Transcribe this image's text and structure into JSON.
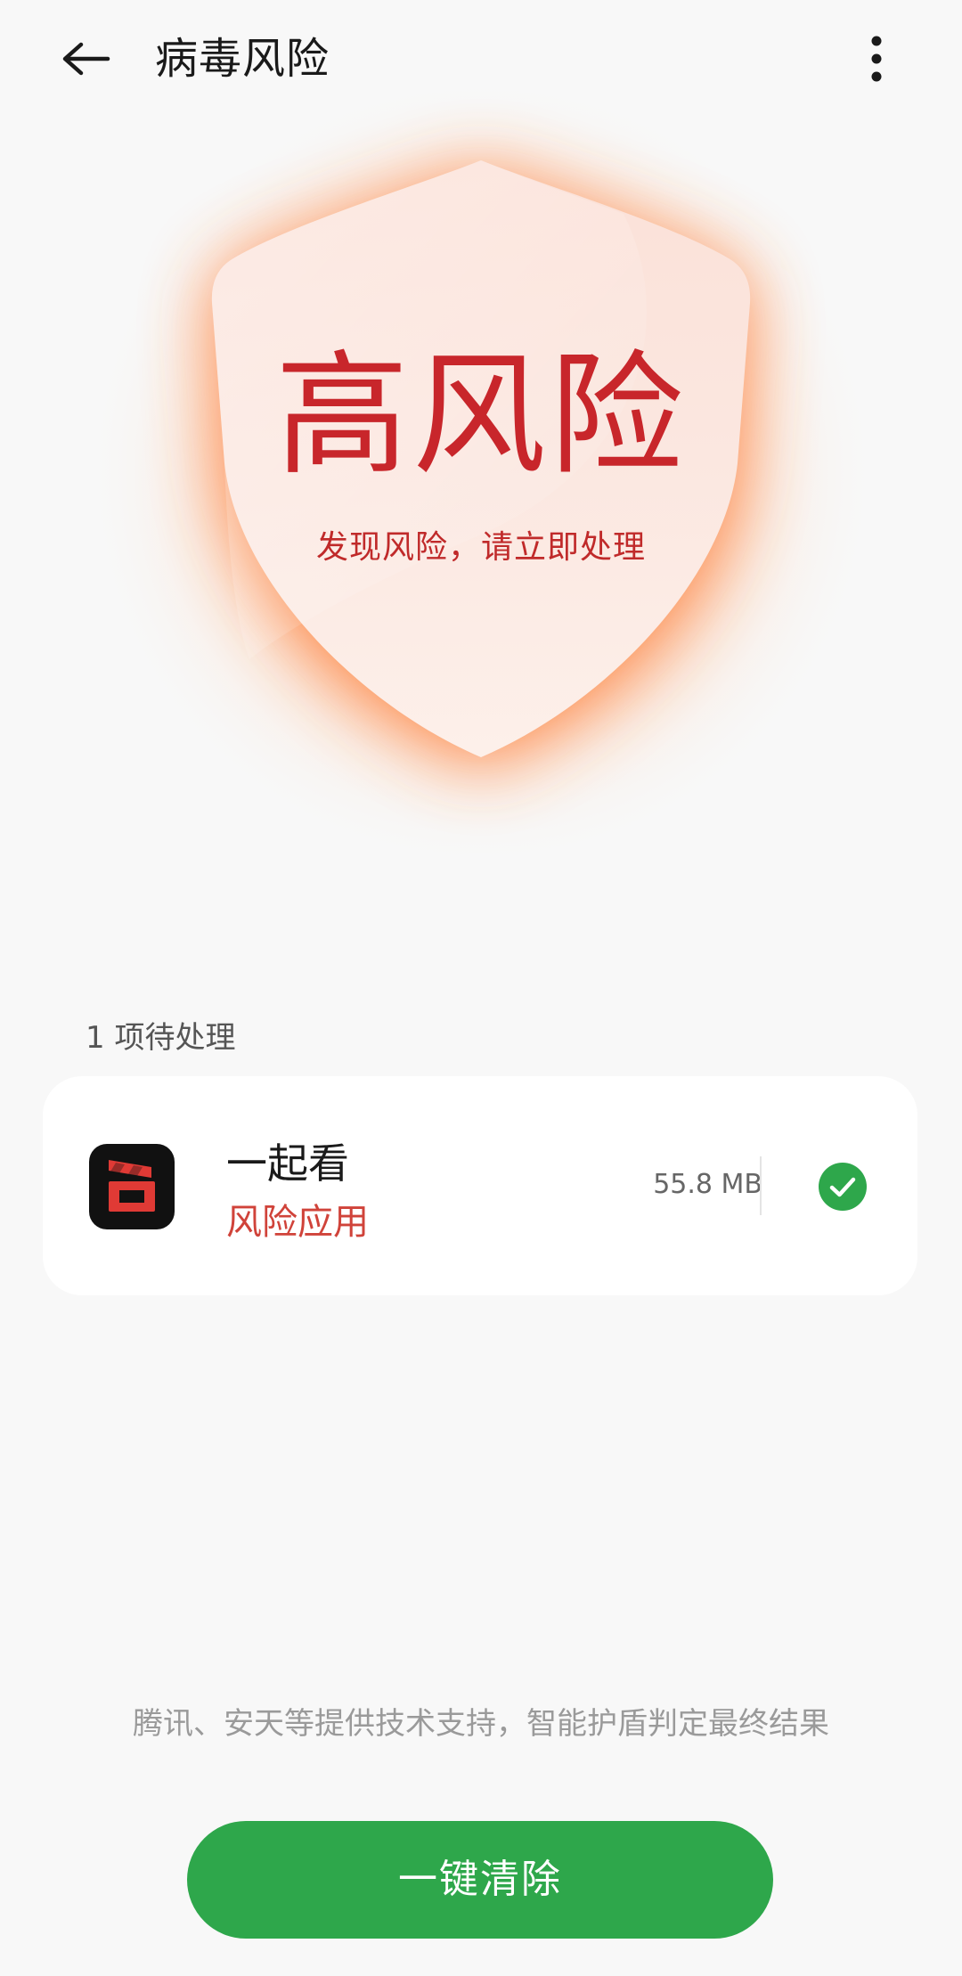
{
  "header": {
    "title": "病毒风险",
    "back_icon": "arrow-left-icon",
    "more_icon": "more-vertical-icon"
  },
  "hero": {
    "risk_level": "高风险",
    "risk_message": "发现风险，请立即处理",
    "shield_icon": "shield-icon"
  },
  "pending": {
    "label": "1 项待处理",
    "items": [
      {
        "name": "一起看",
        "status": "风险应用",
        "size": "55.8 MB",
        "checked": true
      }
    ]
  },
  "footer": {
    "tech_support": "腾讯、安天等提供技术支持，智能护盾判定最终结果",
    "clean_button": "一键清除"
  },
  "colors": {
    "risk_red": "#c8262b",
    "status_red": "#d0433a",
    "primary_green": "#2ea74b",
    "glow_orange": "#ff7a30",
    "background": "#f8f8f8"
  }
}
